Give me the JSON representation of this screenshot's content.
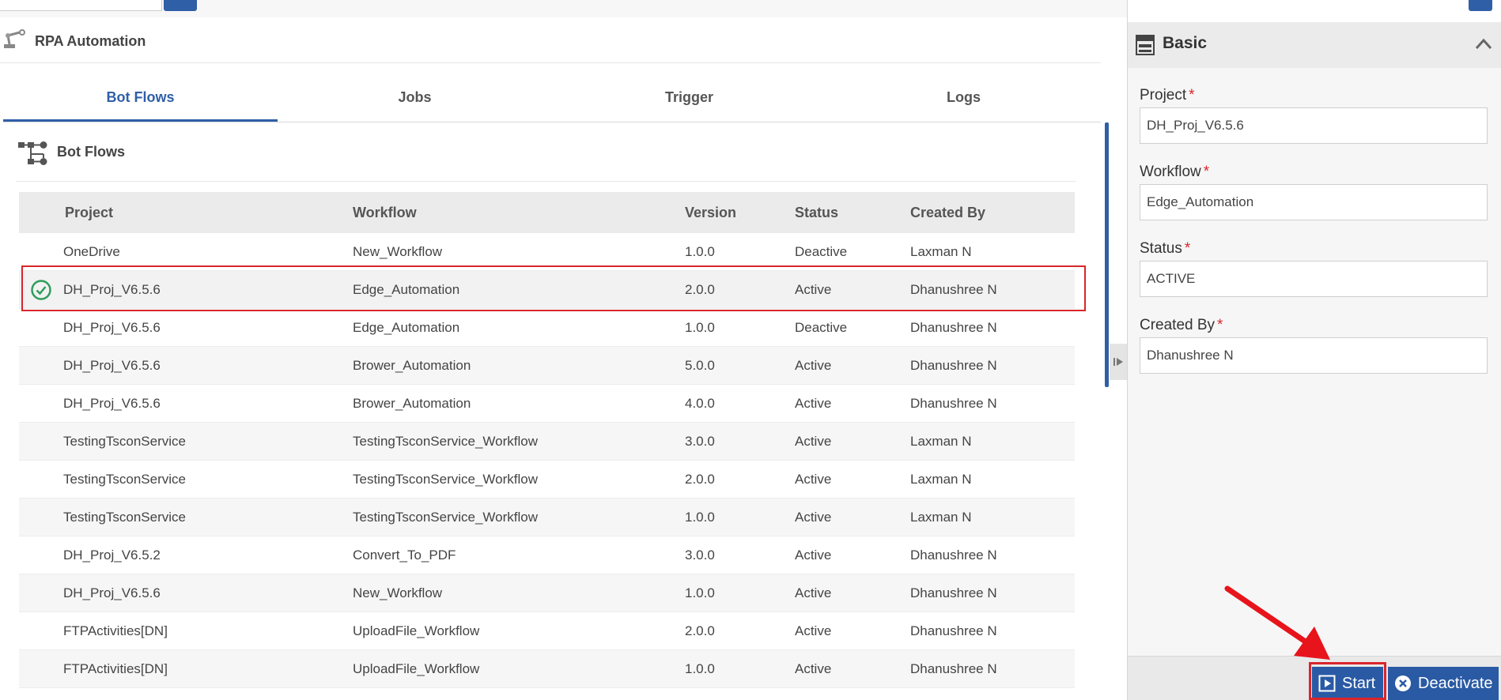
{
  "header": {
    "title": "RPA Automation"
  },
  "tabs": [
    {
      "label": "Bot Flows",
      "active": true
    },
    {
      "label": "Jobs",
      "active": false
    },
    {
      "label": "Trigger",
      "active": false
    },
    {
      "label": "Logs",
      "active": false
    }
  ],
  "section": {
    "title": "Bot Flows"
  },
  "table": {
    "columns": [
      "Project",
      "Workflow",
      "Version",
      "Status",
      "Created By"
    ],
    "rows": [
      {
        "project": "OneDrive",
        "workflow": "New_Workflow",
        "version": "1.0.0",
        "status": "Deactive",
        "created_by": "Laxman N",
        "selected": false
      },
      {
        "project": "DH_Proj_V6.5.6",
        "workflow": "Edge_Automation",
        "version": "2.0.0",
        "status": "Active",
        "created_by": "Dhanushree N",
        "selected": true
      },
      {
        "project": "DH_Proj_V6.5.6",
        "workflow": "Edge_Automation",
        "version": "1.0.0",
        "status": "Deactive",
        "created_by": "Dhanushree N",
        "selected": false
      },
      {
        "project": "DH_Proj_V6.5.6",
        "workflow": "Brower_Automation",
        "version": "5.0.0",
        "status": "Active",
        "created_by": "Dhanushree N",
        "selected": false
      },
      {
        "project": "DH_Proj_V6.5.6",
        "workflow": "Brower_Automation",
        "version": "4.0.0",
        "status": "Active",
        "created_by": "Dhanushree N",
        "selected": false
      },
      {
        "project": "TestingTsconService",
        "workflow": "TestingTsconService_Workflow",
        "version": "3.0.0",
        "status": "Active",
        "created_by": "Laxman N",
        "selected": false
      },
      {
        "project": "TestingTsconService",
        "workflow": "TestingTsconService_Workflow",
        "version": "2.0.0",
        "status": "Active",
        "created_by": "Laxman N",
        "selected": false
      },
      {
        "project": "TestingTsconService",
        "workflow": "TestingTsconService_Workflow",
        "version": "1.0.0",
        "status": "Active",
        "created_by": "Laxman N",
        "selected": false
      },
      {
        "project": "DH_Proj_V6.5.2",
        "workflow": "Convert_To_PDF",
        "version": "3.0.0",
        "status": "Active",
        "created_by": "Dhanushree N",
        "selected": false
      },
      {
        "project": "DH_Proj_V6.5.6",
        "workflow": "New_Workflow",
        "version": "1.0.0",
        "status": "Active",
        "created_by": "Dhanushree N",
        "selected": false
      },
      {
        "project": "FTPActivities[DN]",
        "workflow": "UploadFile_Workflow",
        "version": "2.0.0",
        "status": "Active",
        "created_by": "Dhanushree N",
        "selected": false
      },
      {
        "project": "FTPActivities[DN]",
        "workflow": "UploadFile_Workflow",
        "version": "1.0.0",
        "status": "Active",
        "created_by": "Dhanushree N",
        "selected": false
      }
    ]
  },
  "panel": {
    "title": "Basic",
    "fields": [
      {
        "label": "Project",
        "value": "DH_Proj_V6.5.6"
      },
      {
        "label": "Workflow",
        "value": "Edge_Automation"
      },
      {
        "label": "Status",
        "value": "ACTIVE"
      },
      {
        "label": "Created By",
        "value": "Dhanushree N"
      }
    ],
    "required_mark": "*"
  },
  "footer": {
    "start_label": "Start",
    "deactivate_label": "Deactivate"
  },
  "colors": {
    "accent": "#2f5fa7",
    "highlight": "#d9252b",
    "success": "#2e9e5b"
  },
  "icons": {
    "header": "robot-arm-icon",
    "section": "flow-diagram-icon",
    "panel": "form-icon",
    "collapse": "chevron-up-icon",
    "selected_row": "check-circle-icon",
    "splitter": "expand-right-icon",
    "start": "play-icon",
    "deactivate": "close-circle-icon"
  }
}
